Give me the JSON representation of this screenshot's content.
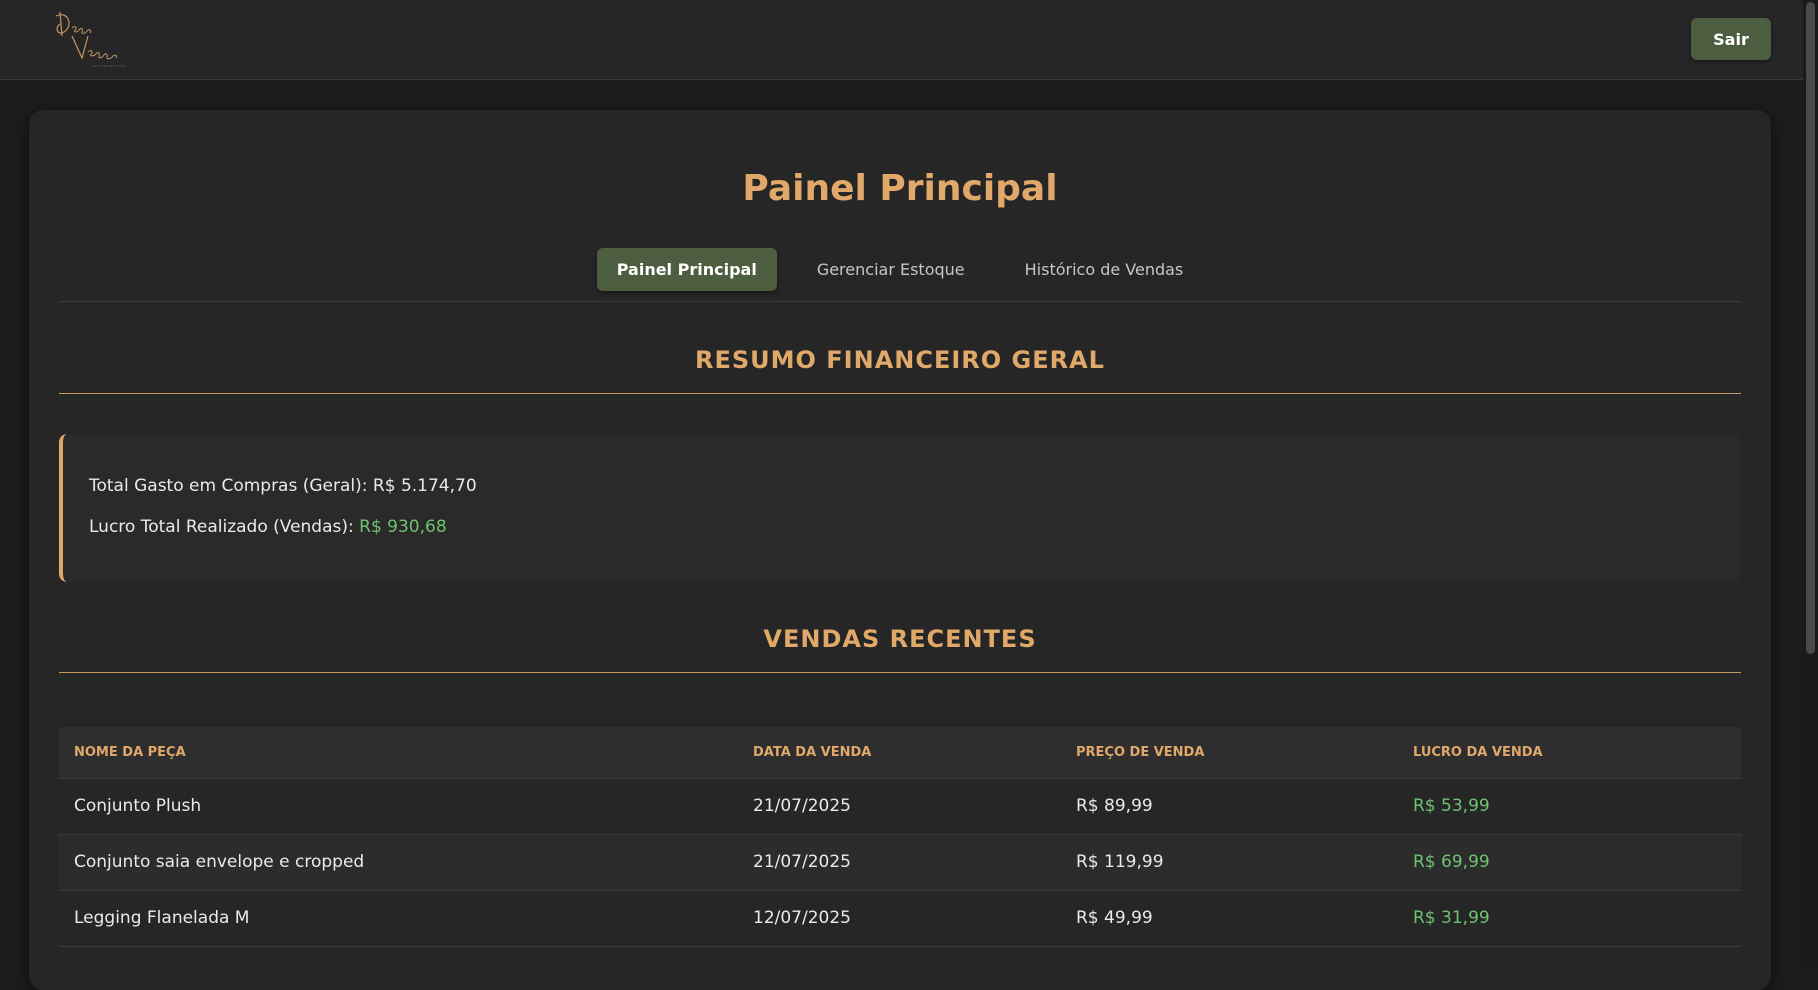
{
  "header": {
    "logo_alt": "Doce Veneno moda feminina",
    "logout_label": "Sair"
  },
  "main": {
    "title": "Painel Principal",
    "tabs": [
      {
        "label": "Painel Principal",
        "active": true
      },
      {
        "label": "Gerenciar Estoque",
        "active": false
      },
      {
        "label": "Histórico de Vendas",
        "active": false
      }
    ]
  },
  "summary": {
    "title": "RESUMO FINANCEIRO GERAL",
    "total_spent_label": "Total Gasto em Compras (Geral):",
    "total_spent_value": "R$ 5.174,70",
    "total_profit_label": "Lucro Total Realizado (Vendas):",
    "total_profit_value": "R$ 930,68"
  },
  "recent_sales": {
    "title": "VENDAS RECENTES",
    "columns": [
      "NOME DA PEÇA",
      "DATA DA VENDA",
      "PREÇO DE VENDA",
      "LUCRO DA VENDA"
    ],
    "rows": [
      {
        "name": "Conjunto Plush",
        "date": "21/07/2025",
        "price": "R$ 89,99",
        "profit": "R$ 53,99"
      },
      {
        "name": "Conjunto saia envelope e cropped",
        "date": "21/07/2025",
        "price": "R$ 119,99",
        "profit": "R$ 69,99"
      },
      {
        "name": "Legging Flanelada M",
        "date": "12/07/2025",
        "price": "R$ 49,99",
        "profit": "R$ 31,99"
      }
    ]
  },
  "colors": {
    "accent": "#e0a869",
    "button_green": "#4d5e40",
    "profit_green": "#6fc36f",
    "background": "#1c1c1c",
    "card": "#262626"
  }
}
